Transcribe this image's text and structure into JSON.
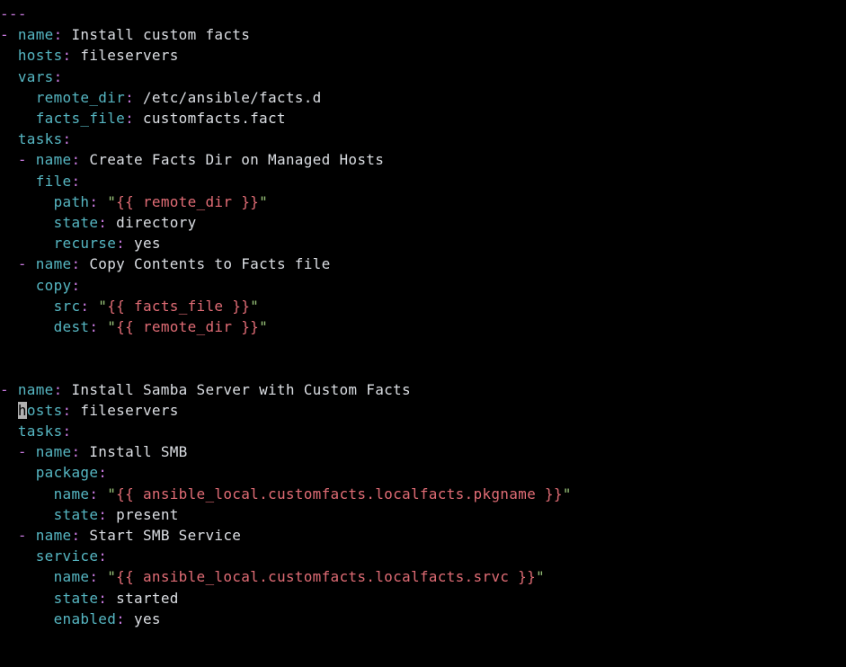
{
  "lines": [
    [
      [
        "p",
        "---"
      ]
    ],
    [
      [
        "p",
        "-"
      ],
      [
        "w",
        " "
      ],
      [
        "c",
        "name"
      ],
      [
        "p",
        ":"
      ],
      [
        "w",
        " Install custom facts"
      ]
    ],
    [
      [
        "w",
        "  "
      ],
      [
        "c",
        "hosts"
      ],
      [
        "p",
        ":"
      ],
      [
        "w",
        " fileservers"
      ]
    ],
    [
      [
        "w",
        "  "
      ],
      [
        "c",
        "vars"
      ],
      [
        "p",
        ":"
      ]
    ],
    [
      [
        "w",
        "    "
      ],
      [
        "c",
        "remote_dir"
      ],
      [
        "p",
        ":"
      ],
      [
        "w",
        " /etc/ansible/facts.d"
      ]
    ],
    [
      [
        "w",
        "    "
      ],
      [
        "c",
        "facts_file"
      ],
      [
        "p",
        ":"
      ],
      [
        "w",
        " customfacts.fact"
      ]
    ],
    [
      [
        "w",
        "  "
      ],
      [
        "c",
        "tasks"
      ],
      [
        "p",
        ":"
      ]
    ],
    [
      [
        "w",
        "  "
      ],
      [
        "p",
        "-"
      ],
      [
        "w",
        " "
      ],
      [
        "c",
        "name"
      ],
      [
        "p",
        ":"
      ],
      [
        "w",
        " Create Facts Dir on Managed Hosts"
      ]
    ],
    [
      [
        "w",
        "    "
      ],
      [
        "c",
        "file"
      ],
      [
        "p",
        ":"
      ]
    ],
    [
      [
        "w",
        "      "
      ],
      [
        "c",
        "path"
      ],
      [
        "p",
        ":"
      ],
      [
        "w",
        " "
      ],
      [
        "g",
        "\""
      ],
      [
        "r",
        "{{ remote_dir }}"
      ],
      [
        "g",
        "\""
      ]
    ],
    [
      [
        "w",
        "      "
      ],
      [
        "c",
        "state"
      ],
      [
        "p",
        ":"
      ],
      [
        "w",
        " directory"
      ]
    ],
    [
      [
        "w",
        "      "
      ],
      [
        "c",
        "recurse"
      ],
      [
        "p",
        ":"
      ],
      [
        "w",
        " yes"
      ]
    ],
    [
      [
        "w",
        "  "
      ],
      [
        "p",
        "-"
      ],
      [
        "w",
        " "
      ],
      [
        "c",
        "name"
      ],
      [
        "p",
        ":"
      ],
      [
        "w",
        " Copy Contents to Facts file"
      ]
    ],
    [
      [
        "w",
        "    "
      ],
      [
        "c",
        "copy"
      ],
      [
        "p",
        ":"
      ]
    ],
    [
      [
        "w",
        "      "
      ],
      [
        "c",
        "src"
      ],
      [
        "p",
        ":"
      ],
      [
        "w",
        " "
      ],
      [
        "g",
        "\""
      ],
      [
        "r",
        "{{ facts_file }}"
      ],
      [
        "g",
        "\""
      ]
    ],
    [
      [
        "w",
        "      "
      ],
      [
        "c",
        "dest"
      ],
      [
        "p",
        ":"
      ],
      [
        "w",
        " "
      ],
      [
        "g",
        "\""
      ],
      [
        "r",
        "{{ remote_dir }}"
      ],
      [
        "g",
        "\""
      ]
    ],
    [
      [
        "w",
        " "
      ]
    ],
    [
      [
        "w",
        " "
      ]
    ],
    [
      [
        "p",
        "-"
      ],
      [
        "w",
        " "
      ],
      [
        "c",
        "name"
      ],
      [
        "p",
        ":"
      ],
      [
        "w",
        " Install Samba Server with Custom Facts"
      ]
    ],
    [
      [
        "w",
        "  "
      ],
      [
        "cur",
        "h"
      ],
      [
        "c",
        "osts"
      ],
      [
        "p",
        ":"
      ],
      [
        "w",
        " fileservers"
      ]
    ],
    [
      [
        "w",
        "  "
      ],
      [
        "c",
        "tasks"
      ],
      [
        "p",
        ":"
      ]
    ],
    [
      [
        "w",
        "  "
      ],
      [
        "p",
        "-"
      ],
      [
        "w",
        " "
      ],
      [
        "c",
        "name"
      ],
      [
        "p",
        ":"
      ],
      [
        "w",
        " Install SMB"
      ]
    ],
    [
      [
        "w",
        "    "
      ],
      [
        "c",
        "package"
      ],
      [
        "p",
        ":"
      ]
    ],
    [
      [
        "w",
        "      "
      ],
      [
        "c",
        "name"
      ],
      [
        "p",
        ":"
      ],
      [
        "w",
        " "
      ],
      [
        "g",
        "\""
      ],
      [
        "r",
        "{{ ansible_local.customfacts.localfacts.pkgname }}"
      ],
      [
        "g",
        "\""
      ]
    ],
    [
      [
        "w",
        "      "
      ],
      [
        "c",
        "state"
      ],
      [
        "p",
        ":"
      ],
      [
        "w",
        " present"
      ]
    ],
    [
      [
        "w",
        "  "
      ],
      [
        "p",
        "-"
      ],
      [
        "w",
        " "
      ],
      [
        "c",
        "name"
      ],
      [
        "p",
        ":"
      ],
      [
        "w",
        " Start SMB Service"
      ]
    ],
    [
      [
        "w",
        "    "
      ],
      [
        "c",
        "service"
      ],
      [
        "p",
        ":"
      ]
    ],
    [
      [
        "w",
        "      "
      ],
      [
        "c",
        "name"
      ],
      [
        "p",
        ":"
      ],
      [
        "w",
        " "
      ],
      [
        "g",
        "\""
      ],
      [
        "r",
        "{{ ansible_local.customfacts.localfacts.srvc }}"
      ],
      [
        "g",
        "\""
      ]
    ],
    [
      [
        "w",
        "      "
      ],
      [
        "c",
        "state"
      ],
      [
        "p",
        ":"
      ],
      [
        "w",
        " started"
      ]
    ],
    [
      [
        "w",
        "      "
      ],
      [
        "c",
        "enabled"
      ],
      [
        "p",
        ":"
      ],
      [
        "w",
        " yes"
      ]
    ]
  ]
}
